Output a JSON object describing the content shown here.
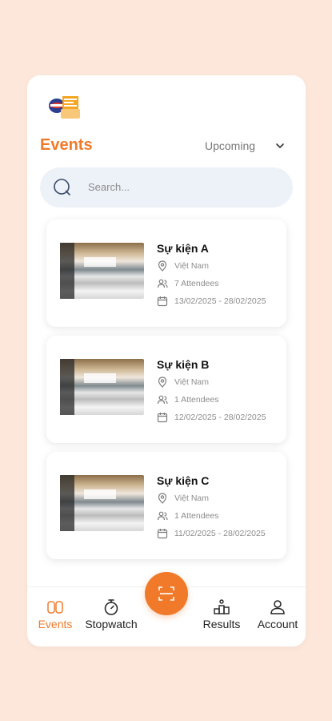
{
  "header": {
    "title": "Events",
    "filter_value": "Upcoming"
  },
  "search": {
    "placeholder": "Search..."
  },
  "events": [
    {
      "name": "Sự kiện A",
      "location": "Việt Nam",
      "attendees": "7 Attendees",
      "dates": "13/02/2025 - 28/02/2025"
    },
    {
      "name": "Sự kiện B",
      "location": "Việt Nam",
      "attendees": "1 Attendees",
      "dates": "12/02/2025 - 28/02/2025"
    },
    {
      "name": "Sự kiện C",
      "location": "Việt Nam",
      "attendees": "1 Attendees",
      "dates": "11/02/2025 - 28/02/2025"
    }
  ],
  "nav": {
    "events": "Events",
    "stopwatch": "Stopwatch",
    "results": "Results",
    "account": "Account"
  },
  "colors": {
    "accent": "#F07A2A",
    "background": "#FCE7DA",
    "search_bg": "#EDF1F8"
  },
  "icons": [
    "app-logo",
    "chevron-down-icon",
    "search-icon",
    "location-pin-icon",
    "users-icon",
    "calendar-icon",
    "events-icon",
    "stopwatch-icon",
    "scan-icon",
    "results-icon",
    "account-icon"
  ]
}
